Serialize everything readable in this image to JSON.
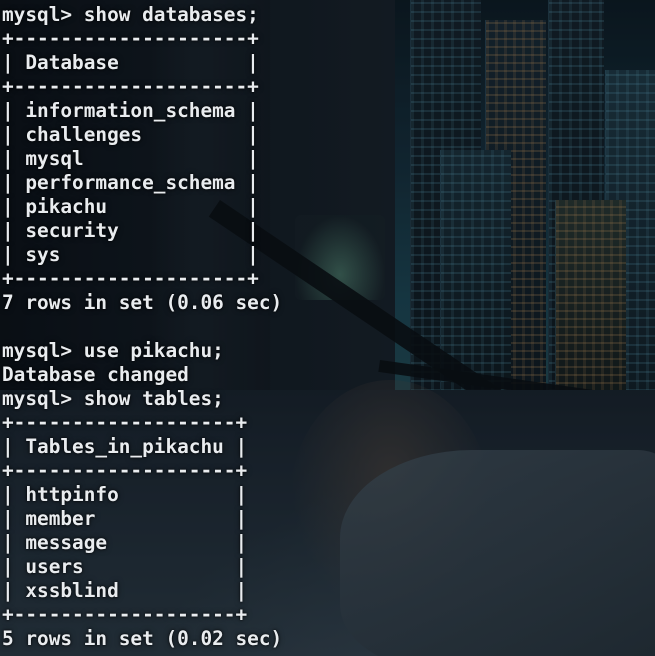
{
  "terminal": {
    "lines": [
      "mysql> show databases;",
      "+--------------------+",
      "| Database           |",
      "+--------------------+",
      "| information_schema |",
      "| challenges         |",
      "| mysql              |",
      "| performance_schema |",
      "| pikachu            |",
      "| security           |",
      "| sys                |",
      "+--------------------+",
      "7 rows in set (0.06 sec)",
      "",
      "mysql> use pikachu;",
      "Database changed",
      "mysql> show tables;",
      "+-------------------+",
      "| Tables_in_pikachu |",
      "+-------------------+",
      "| httpinfo          |",
      "| member            |",
      "| message           |",
      "| users             |",
      "| xssblind          |",
      "+-------------------+",
      "5 rows in set (0.02 sec)"
    ]
  },
  "colors": {
    "text": "#e9ecef",
    "background": "#0b1118"
  }
}
